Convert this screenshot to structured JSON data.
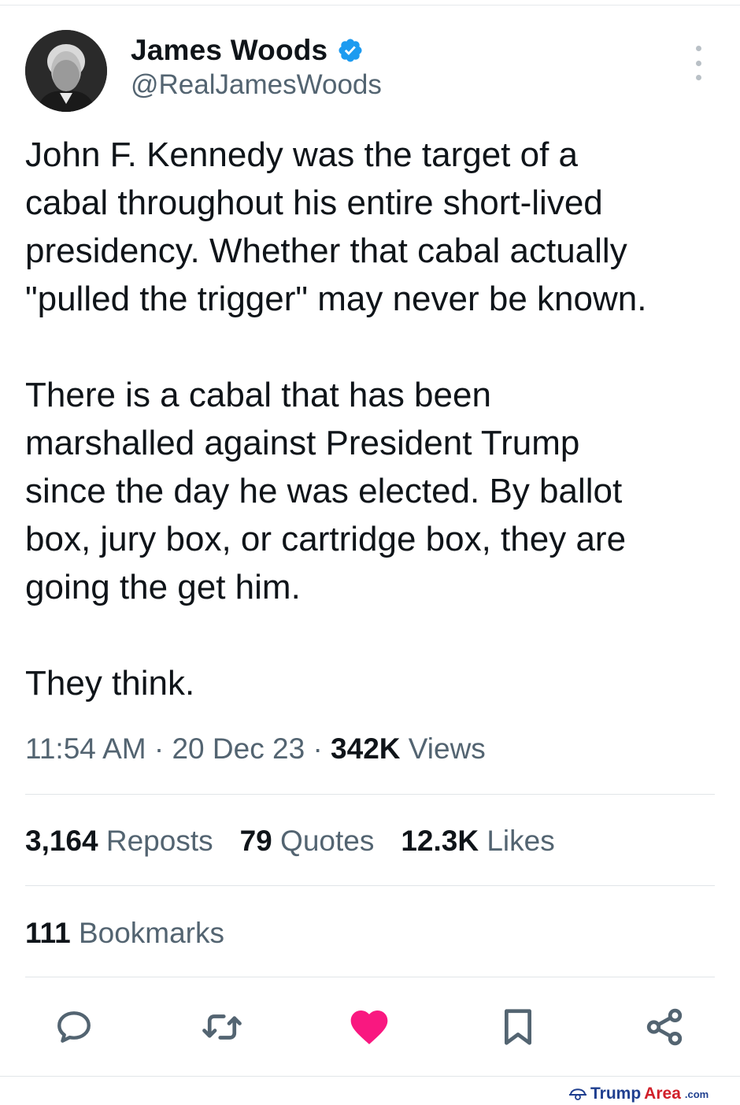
{
  "author": {
    "display_name": "James Woods",
    "handle": "@RealJamesWoods",
    "verified_icon": "verified-badge-icon",
    "verified_color": "#1d9bf0"
  },
  "tweet": {
    "text": "John F. Kennedy was the target of a\ncabal throughout his entire short-lived\npresidency. Whether that cabal actually\n\"pulled the trigger\" may never be known.\n\nThere is a cabal that has been\nmarshalled against President Trump\nsince the day he was elected. By ballot\nbox, jury box, or cartridge box, they are\ngoing the get him.\n\nThey think."
  },
  "meta": {
    "time": "11:54 AM",
    "separator": "·",
    "date": "20 Dec 23",
    "views_count": "342K",
    "views_label": "Views"
  },
  "stats": {
    "reposts_count": "3,164",
    "reposts_label": "Reposts",
    "quotes_count": "79",
    "quotes_label": "Quotes",
    "likes_count": "12.3K",
    "likes_label": "Likes",
    "bookmarks_count": "111",
    "bookmarks_label": "Bookmarks"
  },
  "actions": {
    "icons": [
      "reply-icon",
      "repost-icon",
      "like-icon",
      "bookmark-icon",
      "share-icon"
    ],
    "like_color": "#f91880",
    "icon_color": "#536471"
  },
  "watermark": {
    "brand_part1": "Trump",
    "brand_part2": "Area",
    "brand_suffix": ".com"
  }
}
